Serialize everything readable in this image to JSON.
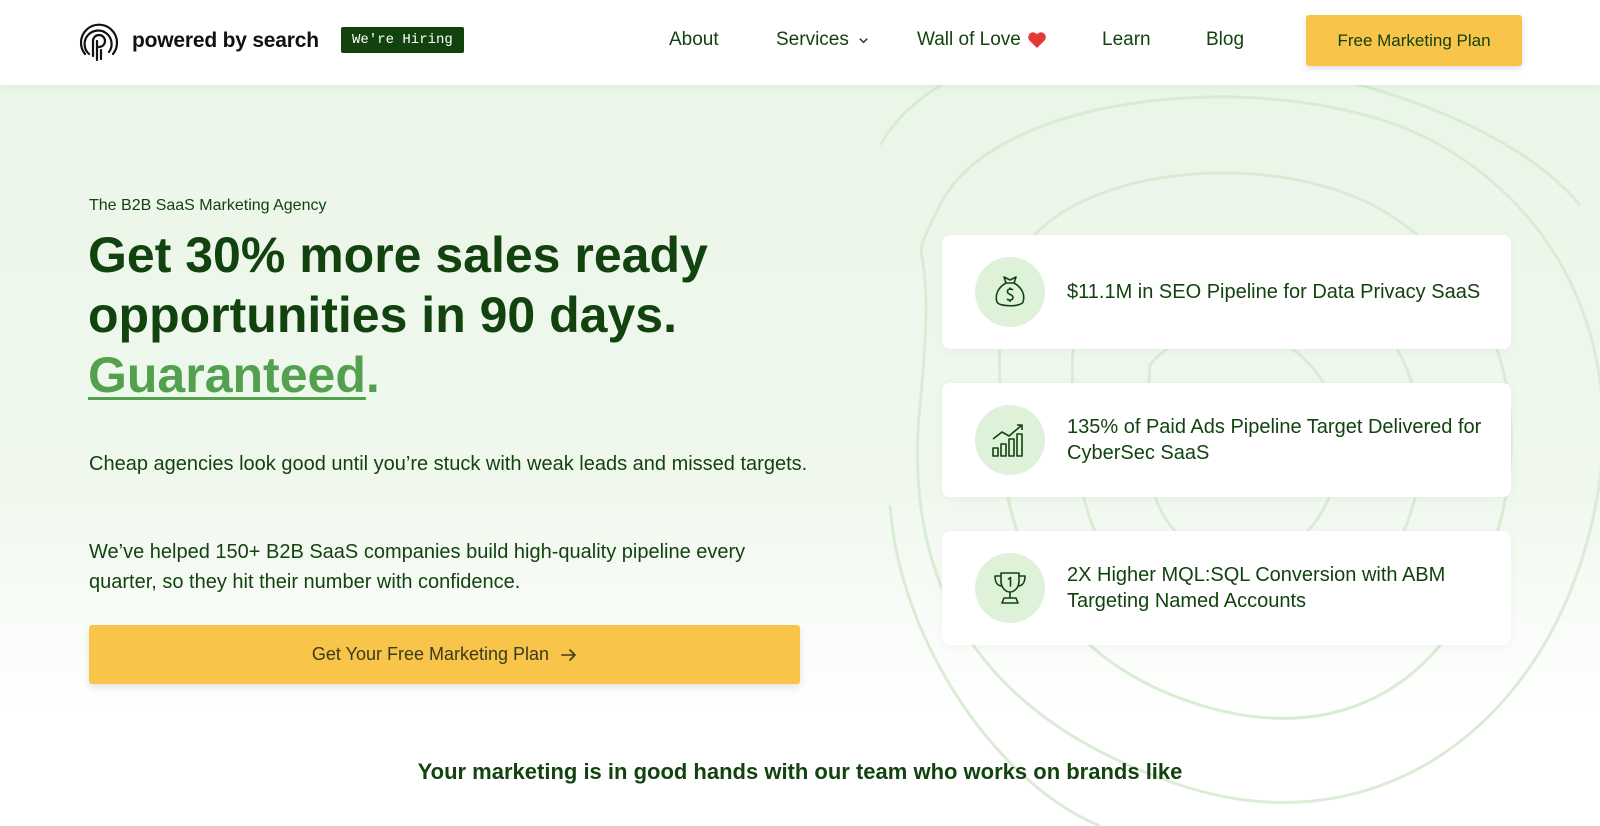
{
  "header": {
    "logo_text": "powered by search",
    "hiring_badge": "We're Hiring",
    "nav": {
      "about": "About",
      "services": "Services",
      "wall_of_love": "Wall of Love",
      "learn": "Learn",
      "blog": "Blog"
    },
    "cta_label": "Free Marketing Plan"
  },
  "hero": {
    "eyebrow": "The B2B SaaS Marketing Agency",
    "headline_line1": "Get 30% more sales ready",
    "headline_line2": "opportunities in 90 days.",
    "headline_emphasis": "Guaranteed",
    "headline_period": ".",
    "paragraph1": "Cheap agencies look good until you’re stuck with weak leads and missed targets.",
    "paragraph2": "We’ve helped 150+ B2B SaaS companies build high-quality pipeline every quarter, so they hit their number with confidence.",
    "cta_label": "Get Your Free Marketing Plan"
  },
  "stats": [
    {
      "icon": "money-bag-icon",
      "text": "$11.1M in SEO Pipeline for Data Privacy SaaS"
    },
    {
      "icon": "growth-chart-icon",
      "text": "135% of Paid Ads Pipeline Target Delivered for CyberSec SaaS"
    },
    {
      "icon": "trophy-icon",
      "text": "2X Higher MQL:SQL Conversion with ABM Targeting Named Accounts"
    }
  ],
  "brands_title": "Your marketing is in good hands with our team who works on brands like",
  "colors": {
    "brand_green": "#12430f",
    "accent_green": "#53a14f",
    "cta_yellow": "#f8c449",
    "icon_circle": "#def2da",
    "hero_bg": "#eaf6e8"
  }
}
